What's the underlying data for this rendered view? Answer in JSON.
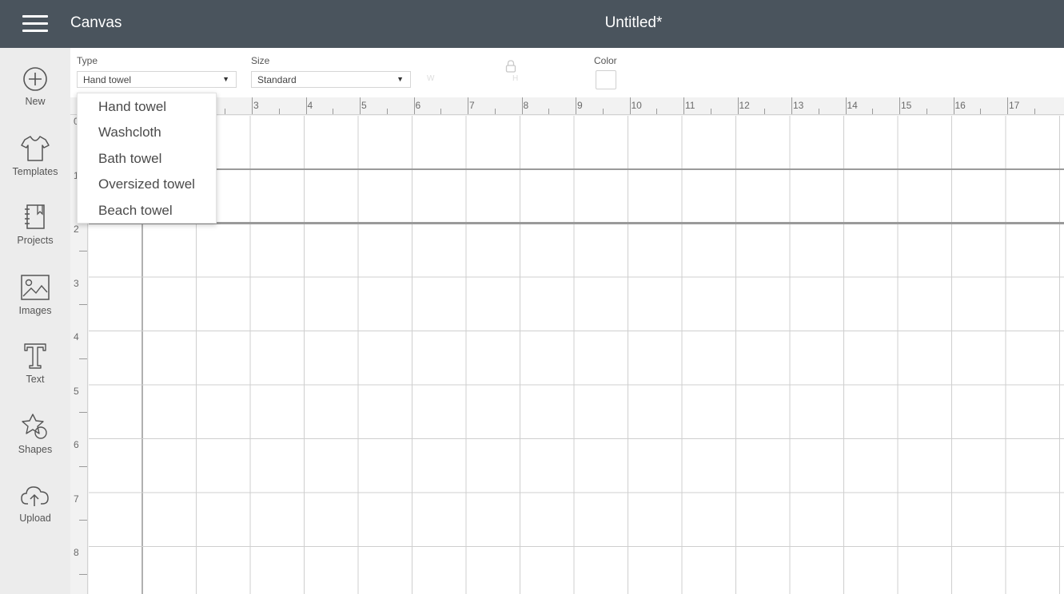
{
  "header": {
    "app_title": "Canvas",
    "doc_title": "Untitled*"
  },
  "sidebar": {
    "items": [
      {
        "label": "New",
        "icon": "plus-circle-icon"
      },
      {
        "label": "Templates",
        "icon": "tshirt-icon"
      },
      {
        "label": "Projects",
        "icon": "notebook-icon"
      },
      {
        "label": "Images",
        "icon": "image-icon"
      },
      {
        "label": "Text",
        "icon": "text-t-icon"
      },
      {
        "label": "Shapes",
        "icon": "shapes-icon"
      },
      {
        "label": "Upload",
        "icon": "cloud-upload-icon"
      }
    ]
  },
  "toolbar": {
    "type_label": "Type",
    "type_value": "Hand towel",
    "size_label": "Size",
    "size_value": "Standard",
    "width_label": "W",
    "height_label": "H",
    "color_label": "Color",
    "color_value": "#ffffff"
  },
  "ruler": {
    "top_ticks": [
      "3",
      "4",
      "5",
      "6",
      "7",
      "8",
      "9",
      "10",
      "11",
      "12",
      "13",
      "14",
      "15",
      "16",
      "17"
    ],
    "left_ticks": [
      "0",
      "1",
      "2",
      "3",
      "4",
      "5",
      "6",
      "7",
      "8"
    ]
  },
  "type_dropdown": {
    "options": [
      "Hand towel",
      "Washcloth",
      "Bath towel",
      "Oversized towel",
      "Beach towel"
    ]
  },
  "colors": {
    "header_bg": "#4a545d",
    "sidebar_bg": "#ececec",
    "grid_line": "#cfcfcf",
    "grid_major": "#9a9a9a"
  }
}
